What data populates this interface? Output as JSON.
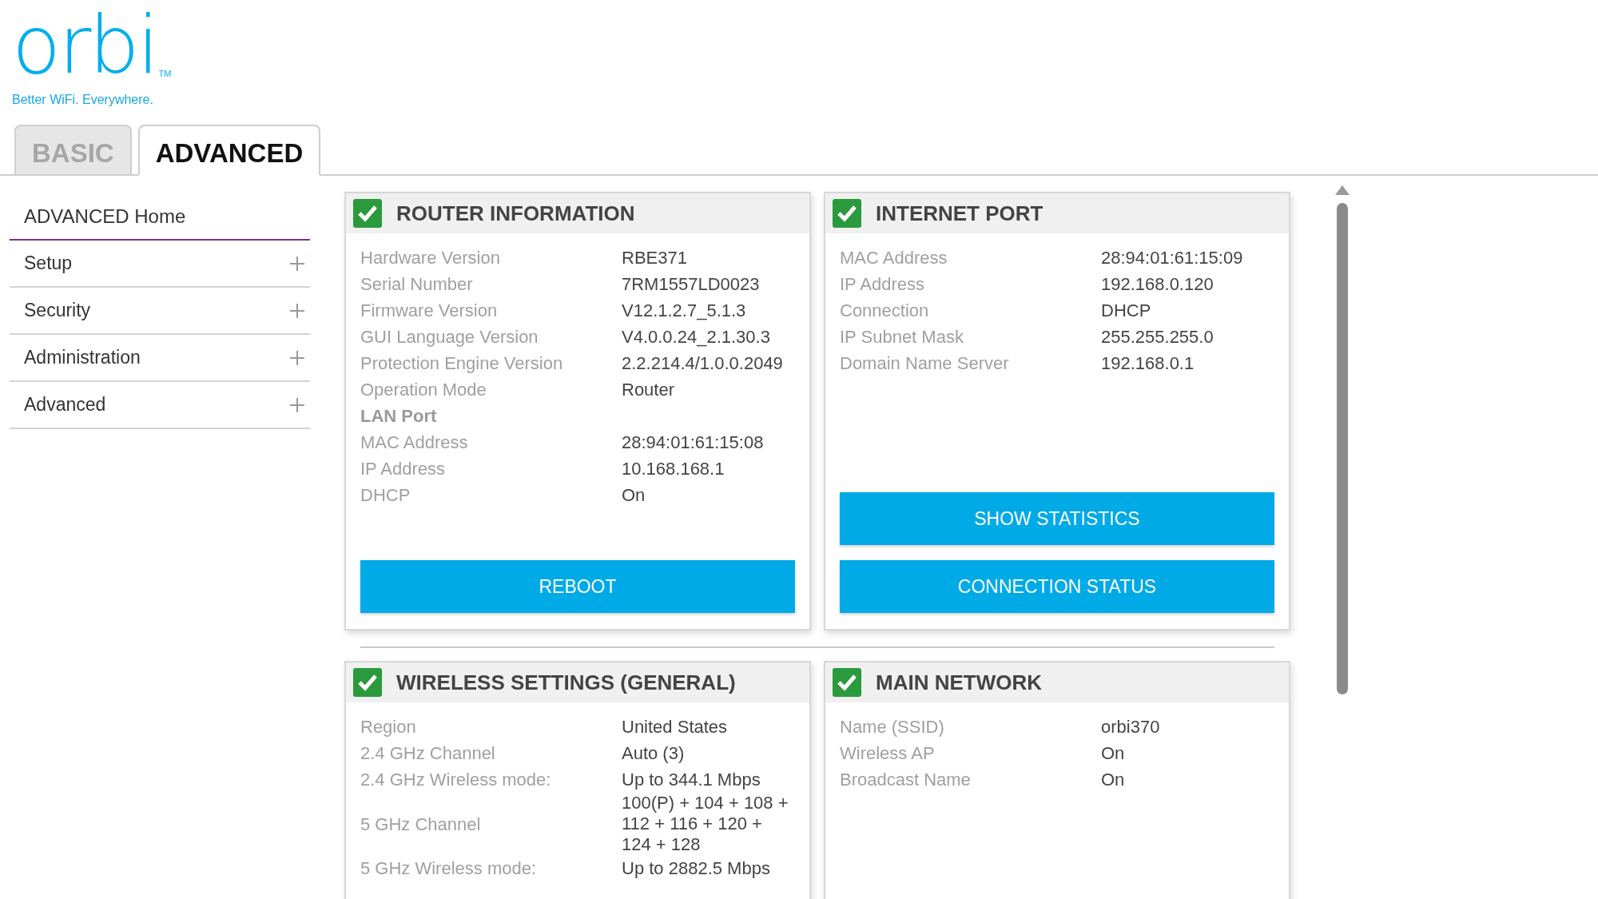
{
  "logo": {
    "text": "orbi",
    "trademark": "TM",
    "tagline": "Better WiFi. Everywhere."
  },
  "tabs": [
    {
      "label": "BASIC",
      "selected": false
    },
    {
      "label": "ADVANCED",
      "selected": true
    }
  ],
  "sidebar": {
    "items": [
      {
        "label": "ADVANCED Home",
        "selected": true,
        "kind": "link"
      },
      {
        "label": "Setup",
        "selected": false,
        "kind": "group",
        "expanded": false
      },
      {
        "label": "Security",
        "selected": false,
        "kind": "group",
        "expanded": false
      },
      {
        "label": "Administration",
        "selected": false,
        "kind": "group",
        "expanded": false
      },
      {
        "label": "Advanced",
        "selected": false,
        "kind": "group",
        "expanded": false
      }
    ]
  },
  "panels": [
    {
      "title": "ROUTER INFORMATION",
      "rows": [
        {
          "kind": "row",
          "label": "Hardware Version",
          "value": "RBE371"
        },
        {
          "kind": "row",
          "label": "Serial Number",
          "value": "7RM1557LD0023"
        },
        {
          "kind": "row",
          "label": "Firmware Version",
          "value": "V12.1.2.7_5.1.3"
        },
        {
          "kind": "row",
          "label": "GUI Language Version",
          "value": "V4.0.0.24_2.1.30.3"
        },
        {
          "kind": "row",
          "label": "Protection Engine Version",
          "value": "2.2.214.4/1.0.0.2049"
        },
        {
          "kind": "row",
          "label": "Operation Mode",
          "value": "Router"
        },
        {
          "kind": "heading",
          "label": "LAN Port"
        },
        {
          "kind": "row",
          "label": "MAC Address",
          "value": "28:94:01:61:15:08"
        },
        {
          "kind": "row",
          "label": "IP Address",
          "value": "10.168.168.1"
        },
        {
          "kind": "row",
          "label": "DHCP",
          "value": "On"
        }
      ],
      "buttons": [
        "REBOOT"
      ]
    },
    {
      "title": "INTERNET PORT",
      "rows": [
        {
          "kind": "row",
          "label": "MAC Address",
          "value": "28:94:01:61:15:09"
        },
        {
          "kind": "row",
          "label": "IP Address",
          "value": "192.168.0.120"
        },
        {
          "kind": "row",
          "label": "Connection",
          "value": "DHCP"
        },
        {
          "kind": "row",
          "label": "IP Subnet Mask",
          "value": "255.255.255.0"
        },
        {
          "kind": "row",
          "label": "Domain Name Server",
          "value": "192.168.0.1"
        }
      ],
      "buttons": [
        "SHOW STATISTICS",
        "CONNECTION STATUS"
      ]
    },
    {
      "title": "WIRELESS SETTINGS (GENERAL)",
      "rows": [
        {
          "kind": "row",
          "label": "Region",
          "value": "United States"
        },
        {
          "kind": "row",
          "label": "2.4 GHz Channel",
          "value": "Auto (3)"
        },
        {
          "kind": "row",
          "label": "2.4 GHz Wireless mode:",
          "value": "Up to 344.1 Mbps"
        },
        {
          "kind": "row",
          "label": "5 GHz Channel",
          "value": "100(P) + 104 + 108 + 112 + 116 + 120 + 124 + 128"
        },
        {
          "kind": "row",
          "label": "5 GHz Wireless mode:",
          "value": "Up to 2882.5 Mbps"
        }
      ]
    },
    {
      "title": "MAIN NETWORK",
      "rows": [
        {
          "kind": "row",
          "label": "Name (SSID)",
          "value": "orbi370"
        },
        {
          "kind": "row",
          "label": "Wireless AP",
          "value": "On"
        },
        {
          "kind": "row",
          "label": "Broadcast Name",
          "value": "On"
        }
      ]
    }
  ]
}
